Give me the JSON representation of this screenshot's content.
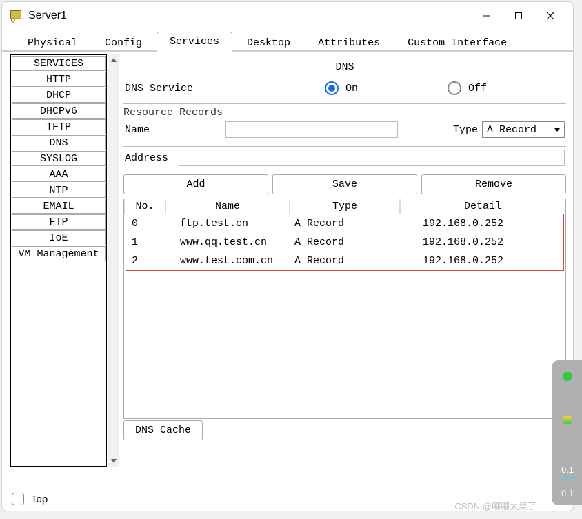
{
  "window": {
    "title": "Server1"
  },
  "tabs": [
    {
      "label": "Physical"
    },
    {
      "label": "Config"
    },
    {
      "label": "Services"
    },
    {
      "label": "Desktop"
    },
    {
      "label": "Attributes"
    },
    {
      "label": "Custom Interface"
    }
  ],
  "active_tab": 2,
  "sidebar": {
    "items": [
      {
        "label": "SERVICES"
      },
      {
        "label": "HTTP"
      },
      {
        "label": "DHCP"
      },
      {
        "label": "DHCPv6"
      },
      {
        "label": "TFTP"
      },
      {
        "label": "DNS"
      },
      {
        "label": "SYSLOG"
      },
      {
        "label": "AAA"
      },
      {
        "label": "NTP"
      },
      {
        "label": "EMAIL"
      },
      {
        "label": "FTP"
      },
      {
        "label": "IoE"
      },
      {
        "label": "VM Management"
      }
    ]
  },
  "dns": {
    "title": "DNS",
    "service_label": "DNS Service",
    "on_label": "On",
    "off_label": "Off",
    "service_state": "on",
    "resource_records_label": "Resource Records",
    "name_label": "Name",
    "name_value": "",
    "type_label": "Type",
    "type_value": "A Record",
    "address_label": "Address",
    "address_value": "",
    "buttons": {
      "add": "Add",
      "save": "Save",
      "remove": "Remove",
      "cache": "DNS Cache"
    },
    "columns": {
      "no": "No.",
      "name": "Name",
      "type": "Type",
      "detail": "Detail"
    },
    "records": [
      {
        "no": "0",
        "name": "ftp.test.cn",
        "type": "A Record",
        "detail": "192.168.0.252"
      },
      {
        "no": "1",
        "name": "www.qq.test.cn",
        "type": "A Record",
        "detail": "192.168.0.252"
      },
      {
        "no": "2",
        "name": "www.test.com.cn",
        "type": "A Record",
        "detail": "192.168.0.252"
      }
    ]
  },
  "footer": {
    "top_label": "Top"
  },
  "watermark": "CSDN @嘟嘟太菜了",
  "sidepanel": {
    "value1": "0.1",
    "unit": "K/s",
    "value2": "0.1"
  }
}
